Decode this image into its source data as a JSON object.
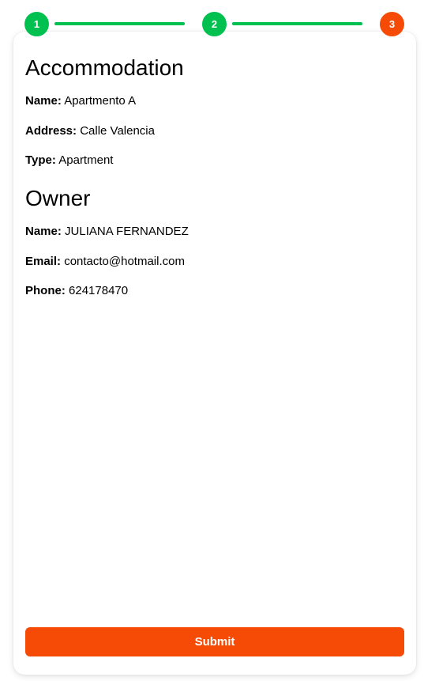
{
  "colors": {
    "step_complete": "#00c050",
    "step_active": "#f64b06",
    "connector": "#00c050",
    "submit_bg": "#f64b06"
  },
  "stepper": {
    "steps": [
      {
        "label": "1",
        "state": "complete"
      },
      {
        "label": "2",
        "state": "complete"
      },
      {
        "label": "3",
        "state": "active"
      }
    ]
  },
  "accommodation": {
    "title": "Accommodation",
    "name_label": "Name:",
    "name_value": "Apartmento A",
    "address_label": "Address:",
    "address_value": "Calle Valencia",
    "type_label": "Type:",
    "type_value": "Apartment"
  },
  "owner": {
    "title": "Owner",
    "name_label": "Name:",
    "name_value": "JULIANA FERNANDEZ",
    "email_label": "Email:",
    "email_value": "contacto@hotmail.com",
    "phone_label": "Phone:",
    "phone_value": "624178470"
  },
  "actions": {
    "submit_label": "Submit"
  }
}
